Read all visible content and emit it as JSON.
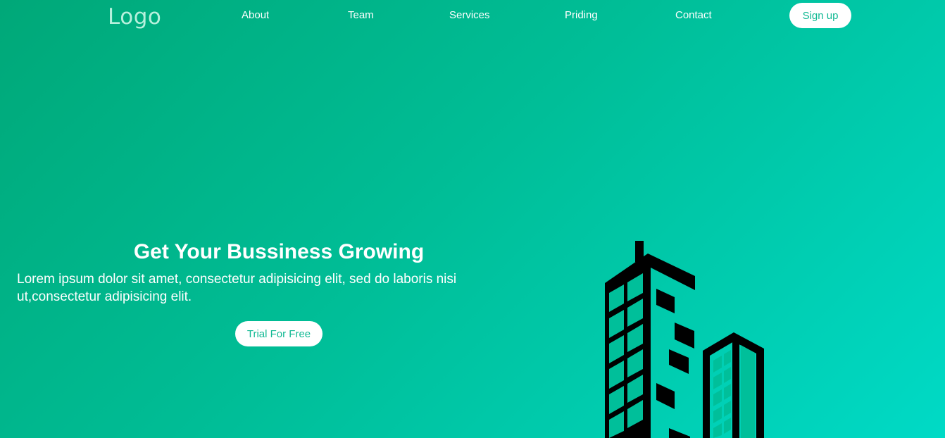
{
  "nav": {
    "logo": "Logo",
    "links": [
      "About",
      "Team",
      "Services",
      "Priding",
      "Contact"
    ],
    "signup_label": "Sign up"
  },
  "hero": {
    "title": "Get Your Bussiness Growing",
    "text": "Lorem ipsum dolor sit amet, consectetur adipisicing elit, sed do laboris nisi ut,consectetur adipisicing elit.",
    "cta_label": "Trial For Free"
  },
  "illustration": {
    "icon": "buildings-icon",
    "color": "#000000"
  },
  "colors": {
    "gradient_start": "#00a878",
    "gradient_end": "#00dac6",
    "button_text": "#11b993"
  }
}
